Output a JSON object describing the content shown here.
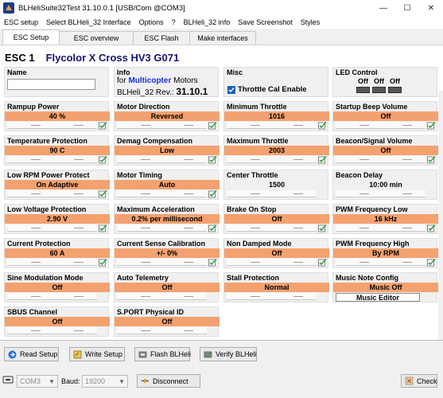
{
  "window": {
    "title": "BLHeliSuite32Test 31.10.0.1  [USB/Com @COM3]",
    "min": "—",
    "max": "☐",
    "close": "✕"
  },
  "menu": [
    "ESC setup",
    "Select BLHeli_32 Interface",
    "Options",
    "?",
    "BLHeli_32 info",
    "Save Screenshot",
    "Styles"
  ],
  "tabs": [
    "ESC Setup",
    "ESC overview",
    "ESC Flash",
    "Make interfaces"
  ],
  "esc": {
    "label": "ESC 1",
    "name": "Flycolor X Cross HV3 G071"
  },
  "name_box": {
    "title": "Name",
    "value": ""
  },
  "info": {
    "title": "Info",
    "for": "for",
    "multicopter": "Multicopter",
    "motors": "Motors",
    "rev_label": "BLHeli_32 Rev.:",
    "rev": "31.10.1"
  },
  "misc": {
    "title": "Misc",
    "throttle_cal": "Throttle Cal Enable",
    "throttle_cal_checked": true
  },
  "led": {
    "title": "LED Control",
    "labels": [
      "Off",
      "Off",
      "Off"
    ]
  },
  "params": {
    "rampup": {
      "title": "Rampup Power",
      "value": "40 %"
    },
    "motor_dir": {
      "title": "Motor Direction",
      "value": "Reversed"
    },
    "min_thr": {
      "title": "Minimum Throttle",
      "value": "1016"
    },
    "startup_beep": {
      "title": "Startup Beep Volume",
      "value": "Off"
    },
    "temp": {
      "title": "Temperature Protection",
      "value": "90 C"
    },
    "demag": {
      "title": "Demag Compensation",
      "value": "Low"
    },
    "max_thr": {
      "title": "Maximum Throttle",
      "value": "2003"
    },
    "beacon_vol": {
      "title": "Beacon/Signal Volume",
      "value": "Off"
    },
    "low_rpm": {
      "title": "Low RPM Power Protect",
      "value": "On Adaptive"
    },
    "timing": {
      "title": "Motor Timing",
      "value": "Auto"
    },
    "center_thr": {
      "title": "Center Throttle",
      "value": "1500"
    },
    "beacon_delay": {
      "title": "Beacon Delay",
      "value": "10:00 min"
    },
    "low_volt": {
      "title": "Low Voltage Protection",
      "value": "2.90 V"
    },
    "max_accel": {
      "title": "Maximum Acceleration",
      "value": "0.2% per millisecond"
    },
    "brake_stop": {
      "title": "Brake On Stop",
      "value": "Off"
    },
    "pwm_low": {
      "title": "PWM Frequency Low",
      "value": "16 kHz"
    },
    "current_prot": {
      "title": "Current Protection",
      "value": "60 A"
    },
    "current_cal": {
      "title": "Current Sense Calibration",
      "value": "+/- 0%"
    },
    "non_damped": {
      "title": "Non Damped Mode",
      "value": "Off"
    },
    "pwm_high": {
      "title": "PWM Frequency High",
      "value": "By RPM"
    },
    "sine_mod": {
      "title": "Sine Modulation Mode",
      "value": "Off"
    },
    "auto_tel": {
      "title": "Auto Telemetry",
      "value": "Off"
    },
    "stall_prot": {
      "title": "Stall Protection",
      "value": "Normal"
    },
    "music_note": {
      "title": "Music Note Config",
      "value": "Music Off",
      "editor": "Music Editor"
    },
    "sbus": {
      "title": "SBUS Channel",
      "value": "Off"
    },
    "sport": {
      "title": "S.PORT Physical ID",
      "value": "Off"
    }
  },
  "actions": {
    "read": "Read Setup",
    "write": "Write Setup",
    "flash": "Flash BLHeli",
    "verify": "Verify BLHeli"
  },
  "bottom": {
    "port": "COM3",
    "baud_label": "Baud:",
    "baud": "19200",
    "disconnect": "Disconnect",
    "check": "Check"
  },
  "colors": {
    "accent": "#f4a170",
    "brand": "#14146e",
    "multicopter": "#1a2fd6"
  }
}
